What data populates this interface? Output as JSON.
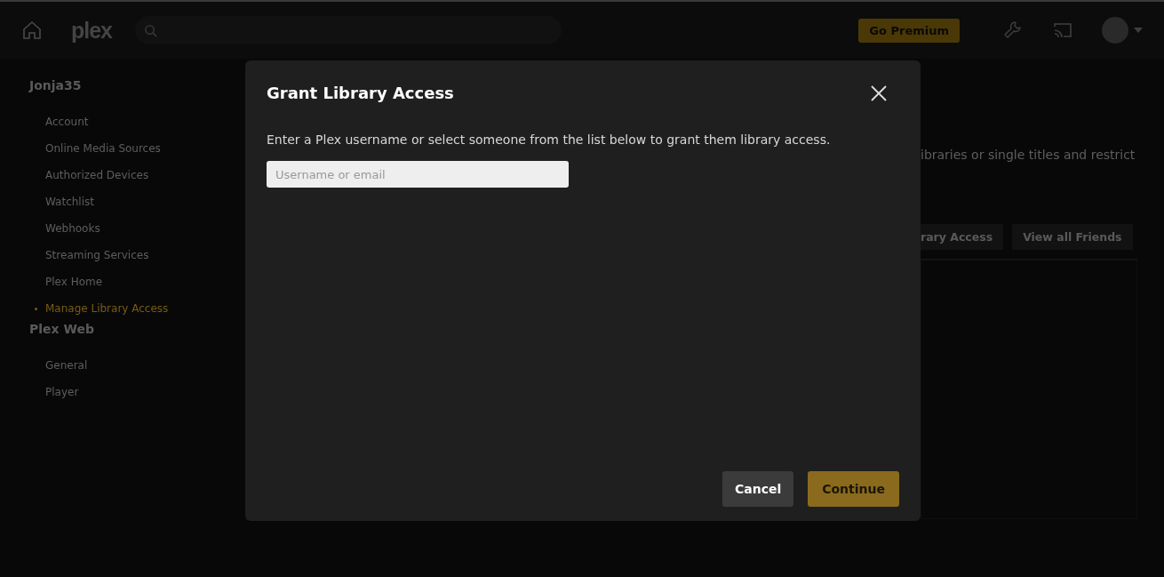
{
  "top_bar": {
    "logo": "plex",
    "premium_button": "Go Premium"
  },
  "sidebar": {
    "sections": [
      {
        "title": "Jonja35",
        "items": [
          {
            "label": "Account",
            "selected": false
          },
          {
            "label": "Online Media Sources",
            "selected": false
          },
          {
            "label": "Authorized Devices",
            "selected": false
          },
          {
            "label": "Watchlist",
            "selected": false
          },
          {
            "label": "Webhooks",
            "selected": false
          },
          {
            "label": "Streaming Services",
            "selected": false
          },
          {
            "label": "Plex Home",
            "selected": false
          },
          {
            "label": "Manage Library Access",
            "selected": true
          }
        ]
      },
      {
        "title": "Plex Web",
        "items": [
          {
            "label": "General",
            "selected": false
          },
          {
            "label": "Player",
            "selected": false
          }
        ]
      }
    ]
  },
  "main": {
    "description": "ibraries or single titles and restrict",
    "buttons": [
      "rary Access",
      "View all Friends"
    ]
  },
  "dialog": {
    "title": "Grant Library Access",
    "text": "Enter a Plex username or select someone from the list below to grant them library access.",
    "field": {
      "placeholder": "Username or email"
    },
    "cancel": "Cancel",
    "continue": "Continue"
  }
}
